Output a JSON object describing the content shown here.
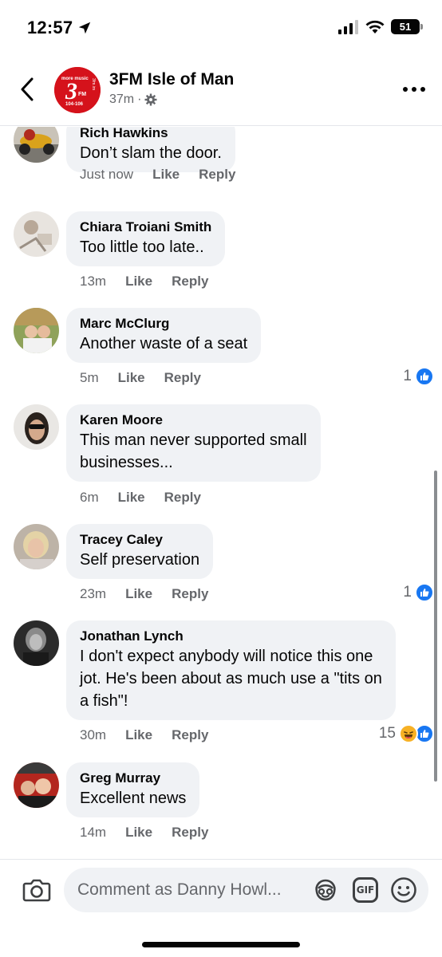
{
  "status_bar": {
    "time": "12:57",
    "battery": "51"
  },
  "header": {
    "page_name": "3FM Isle of Man",
    "post_age": "37m",
    "separator": "·"
  },
  "logo": {
    "top_text": "more music",
    "number": "3",
    "fm": "FM",
    "freq": "104-106",
    "side": "3fm.im"
  },
  "actions": {
    "like": "Like",
    "reply": "Reply"
  },
  "comments": [
    {
      "author": "Rich Hawkins",
      "text": "Don’t slam the door.",
      "time": "Just now",
      "reaction_count": ""
    },
    {
      "author": "Chiara Troiani Smith",
      "text": "Too little too late..",
      "time": "13m",
      "reaction_count": ""
    },
    {
      "author": "Marc McClurg",
      "text": "Another waste of a seat",
      "time": "5m",
      "reaction_count": "1"
    },
    {
      "author": "Karen Moore",
      "text_lines": [
        "This man never supported small",
        "businesses..."
      ],
      "time": "6m",
      "reaction_count": ""
    },
    {
      "author": "Tracey Caley",
      "text": "Self preservation",
      "time": "23m",
      "reaction_count": "1"
    },
    {
      "author": "Jonathan Lynch",
      "text_lines": [
        "I don't expect anybody will notice this one",
        "jot. He's been about as much use a \"tits on",
        "a fish\"!"
      ],
      "time": "30m",
      "reaction_count": "15"
    },
    {
      "author": "Greg Murray",
      "text": "Excellent news",
      "time": "14m",
      "reaction_count": ""
    }
  ],
  "composer": {
    "placeholder": "Comment as Danny Howl...",
    "gif_label": "GIF"
  },
  "colors": {
    "brand_blue": "#1877f2",
    "bubble_bg": "#f0f2f5",
    "secondary_text": "#65676b",
    "logo_red": "#d5121b"
  },
  "icons": [
    "location-arrow-icon",
    "signal-icon",
    "wifi-icon",
    "battery-icon",
    "back-chevron-icon",
    "gear-icon",
    "more-icon",
    "like-icon",
    "haha-icon",
    "camera-icon",
    "avatar-sticker-icon",
    "gif-icon",
    "emoji-icon"
  ]
}
